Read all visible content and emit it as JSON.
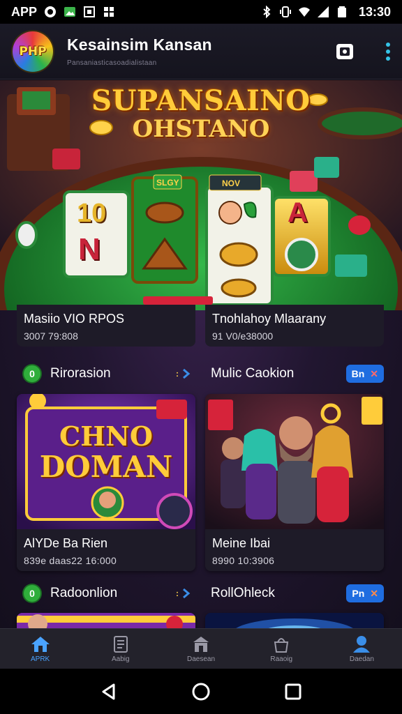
{
  "status_bar": {
    "app_label": "APP",
    "time": "13:30",
    "left_icons": [
      "chat-icon",
      "photo-icon",
      "screen-icon",
      "apps-icon"
    ],
    "right_icons": [
      "bluetooth-icon",
      "vibrate-icon",
      "wifi-icon",
      "signal-icon",
      "battery-icon"
    ]
  },
  "app_bar": {
    "logo_text": "PHP",
    "title": "Kesainsim Kansan",
    "subtitle": "Pansaniasticasoadialistaan",
    "actions": [
      "screen-record-icon",
      "more-vert-icon"
    ]
  },
  "hero": {
    "title": "SUPANSAINO",
    "subtitle": "OHSTANO",
    "reel_labels": [
      "SLGY",
      "NOV"
    ],
    "reel_symbols": [
      "10",
      "N",
      "A"
    ],
    "cards": [
      {
        "title": "Masiio VIO RPOS",
        "meta": "3007 79:808"
      },
      {
        "title": "Tnohlahoy Mlaarany",
        "meta": "91 V0/e38000"
      }
    ]
  },
  "section1": {
    "left": {
      "badge": "0",
      "label": "Rirorasion"
    },
    "right": {
      "label": "Mulic Caokion",
      "pill": "Bn"
    }
  },
  "cards_row1": [
    {
      "art_text_top": "CHNO",
      "art_text_bottom": "DOMAN",
      "title": "AlYDe Ba Rien",
      "meta": "839e daas22 16:000"
    },
    {
      "title": "Meine Ibai",
      "meta": "8990 10:3906"
    }
  ],
  "section2": {
    "left": {
      "badge": "0",
      "label": "Radoonlion"
    },
    "right": {
      "label": "RollOhleck",
      "pill": "Pn"
    }
  },
  "bottom_nav": [
    {
      "label": "APRK",
      "icon": "home-icon",
      "active": true
    },
    {
      "label": "Aabig",
      "icon": "list-icon",
      "active": false
    },
    {
      "label": "Daesean",
      "icon": "store-icon",
      "active": false
    },
    {
      "label": "Raaoig",
      "icon": "cart-icon",
      "active": false
    },
    {
      "label": "Daedan",
      "icon": "profile-icon",
      "active": false
    }
  ],
  "colors": {
    "accent": "#1f6de0",
    "active_nav": "#4aa3ff",
    "badge": "#2fae3b",
    "felt": "#1f8a2c",
    "gold": "#ffcc3a"
  }
}
